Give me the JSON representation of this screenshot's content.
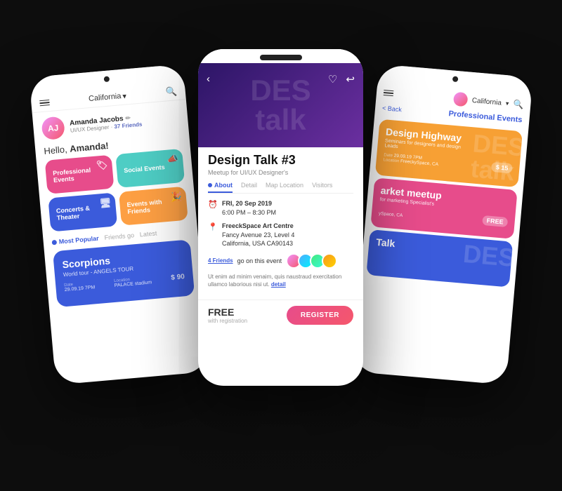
{
  "background": "#0d0d0d",
  "phones": {
    "left": {
      "status": {
        "time": "",
        "battery": ""
      },
      "nav": {
        "location": "California",
        "dropdown": "▾"
      },
      "profile": {
        "name": "Amanda Jacobs",
        "role": "UI/UX Designer",
        "friends": "37 Friends"
      },
      "greeting": "Hello, ",
      "greeting_name": "Amanda!",
      "categories": [
        {
          "id": "professional",
          "label": "Professional Events",
          "color": "cat-professional",
          "icon": "🏷"
        },
        {
          "id": "social",
          "label": "Social Events",
          "color": "cat-social",
          "icon": "📣"
        },
        {
          "id": "concerts",
          "label": "Concerts & Theater",
          "color": "cat-concerts",
          "icon": "🖥"
        },
        {
          "id": "friends",
          "label": "Events with Friends",
          "color": "cat-friends",
          "icon": "🎉"
        }
      ],
      "tabs": [
        {
          "label": "Most Popular",
          "active": true
        },
        {
          "label": "Friends go",
          "active": false
        },
        {
          "label": "Latest",
          "active": false
        }
      ],
      "featured_event": {
        "title": "Scorpions",
        "subtitle": "World tour - ANGELS TOUR",
        "date_label": "Date",
        "date": "29.09.19 7PM",
        "location_label": "Location",
        "location": "PALACE stadium",
        "price": "$ 90"
      }
    },
    "center": {
      "hero_bg_text": "DES\ntalk",
      "event_title": "Design Talk #3",
      "event_subtitle": "Meetup for UI/UX Designer's",
      "tabs": [
        {
          "label": "About",
          "active": true
        },
        {
          "label": "Detail",
          "active": false
        },
        {
          "label": "Map Location",
          "active": false
        },
        {
          "label": "Visitors",
          "active": false
        }
      ],
      "date_icon": "⏰",
      "date": "FRI, 20 Sep 2019",
      "time": "6:00 PM – 8:30 PM",
      "location_icon": "📍",
      "venue": "FreeckSpace Art Centre",
      "address1": "Fancy Avenue 23, Level 4",
      "address2": "California, USA CA90143",
      "friends_label": "4 Friends",
      "friends_go_label": "go on this event",
      "description": "Ut enim ad minim venaim, quis naustraud exercitation ullamco laborious nisi ut.",
      "detail_link": "detail",
      "price": "FREE",
      "price_sub": "with registration",
      "register_label": "REGISTER"
    },
    "right": {
      "back_label": "< Back",
      "page_title": "Professional Events",
      "nav_location": "California",
      "cards": [
        {
          "id": "design-highway",
          "title": "Design Highway",
          "subtitle": "Seminars for designers and design Leads",
          "bg_text": "DES\ntalk",
          "date_label": "Date",
          "date": "29.09.19 7PM",
          "location_label": "Location",
          "location": "FreeckySpace, CA",
          "price": "$ 15",
          "color": "right-card-orange"
        },
        {
          "id": "market-meetup",
          "title": "arket meetup",
          "subtitle": "for marketing Specialist's",
          "bg_text": "",
          "location": "ySpace, CA",
          "price": "FREE",
          "color": "right-card-pink"
        },
        {
          "id": "talk",
          "title": "Talk",
          "subtitle": "DES",
          "bg_text": "",
          "color": "right-card-blue"
        }
      ]
    }
  }
}
